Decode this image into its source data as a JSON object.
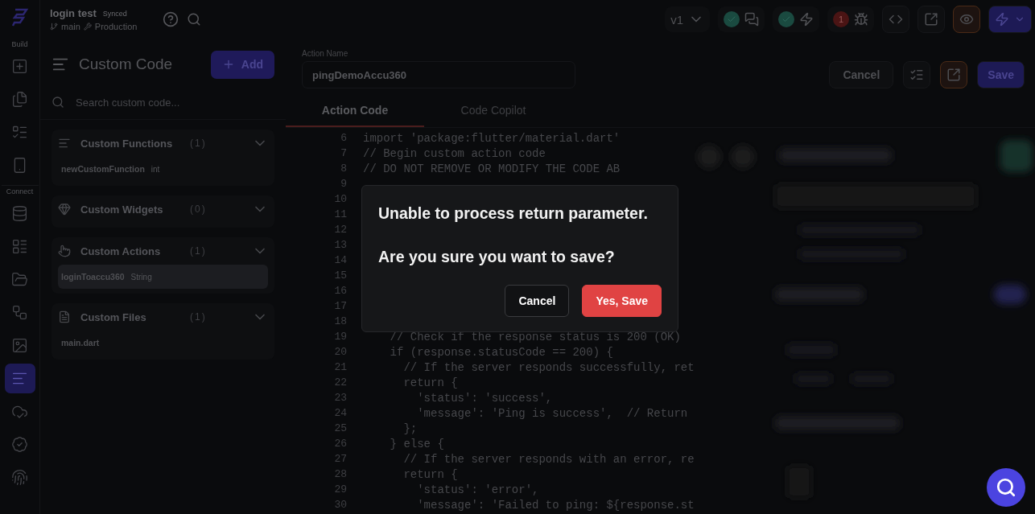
{
  "rail": {
    "sections": [
      {
        "label": "Build",
        "items": [
          {
            "selected": false
          },
          {
            "selected": false
          },
          {
            "selected": false
          },
          {
            "selected": false
          }
        ]
      },
      {
        "label": "Connect",
        "items": [
          {
            "selected": false
          },
          {
            "selected": false
          },
          {
            "selected": false
          },
          {
            "selected": false
          },
          {
            "selected": false
          },
          {
            "selected": true
          },
          {
            "selected": false
          },
          {
            "selected": false
          },
          {
            "selected": false
          }
        ]
      }
    ]
  },
  "top_bar": {
    "project": "login test",
    "sync_status": "Synced",
    "branch": "main",
    "environment": "Production",
    "version": "v1",
    "error_count": "1"
  },
  "custom_code": {
    "title": "Custom Code",
    "add_button": "Add",
    "search": {
      "placeholder": "Search custom code..."
    },
    "sections": [
      {
        "title": "Custom Functions",
        "count": "(1)",
        "items": [
          {
            "name": "newCustomFunction",
            "type": "int",
            "selected": false
          }
        ]
      },
      {
        "title": "Custom Widgets",
        "count": "(0)"
      },
      {
        "title": "Custom Actions",
        "count": "(1)",
        "items": [
          {
            "name": "loginToaccu360",
            "type": "String",
            "selected": true
          }
        ]
      },
      {
        "title": "Custom Files",
        "count": "(1)",
        "items": [
          {
            "name": "main.dart",
            "selected": false
          }
        ]
      }
    ]
  },
  "editor": {
    "action_name": {
      "label": "Action Name",
      "value": "pingDemoAccu360"
    },
    "cancel_button": "Cancel",
    "save_button": "Save",
    "tabs": [
      {
        "label": "Action Code",
        "selected": true
      },
      {
        "label": "Code Copilot",
        "selected": false
      }
    ],
    "lines": [
      {
        "number": "6",
        "code": "import 'package:flutter/material.dart'"
      },
      {
        "number": "7",
        "code": "// Begin custom action code"
      },
      {
        "number": "8",
        "code": "// DO NOT REMOVE OR MODIFY THE CODE AB"
      },
      {
        "number": "9"
      },
      {
        "number": "10"
      },
      {
        "number": "11"
      },
      {
        "number": "12"
      },
      {
        "number": "13"
      },
      {
        "number": "14"
      },
      {
        "number": "15"
      },
      {
        "number": "16"
      },
      {
        "number": "17"
      },
      {
        "number": "18"
      },
      {
        "number": "19",
        "code": "    // Check if the response status is 200 (OK)"
      },
      {
        "number": "20",
        "code": "    if (response.statusCode == 200) {"
      },
      {
        "number": "21",
        "code": "      // If the server responds successfully, ret"
      },
      {
        "number": "22",
        "code": "      return {"
      },
      {
        "number": "23",
        "code": "        'status': 'success',"
      },
      {
        "number": "24",
        "code": "        'message': 'Ping is success',  // Return"
      },
      {
        "number": "25",
        "code": "      };"
      },
      {
        "number": "26",
        "code": "    } else {"
      },
      {
        "number": "27",
        "code": "      // If the server responds with an error, re"
      },
      {
        "number": "28",
        "code": "      return {"
      },
      {
        "number": "29",
        "code": "        'status': 'error',"
      },
      {
        "number": "30",
        "code": "        'message': 'Failed to ping: ${response.st"
      }
    ]
  },
  "dialog": {
    "message": "Unable to process return parameter.",
    "question": "Are you sure you want to save?",
    "buttons": [
      {
        "label": "Cancel",
        "kind": "secondary"
      },
      {
        "label": "Yes, Save",
        "kind": "danger"
      }
    ]
  }
}
